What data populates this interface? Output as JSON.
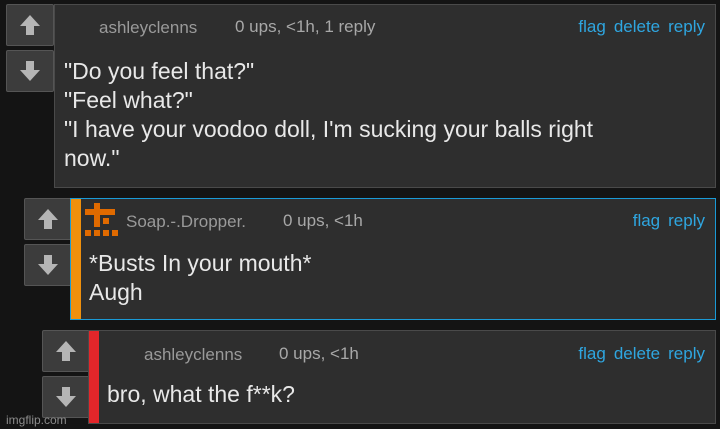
{
  "comments": [
    {
      "username": "ashleyclenns",
      "meta": "0 ups, <1h, 1 reply",
      "actions": {
        "flag": "flag",
        "delete": "delete",
        "reply": "reply"
      },
      "lines": [
        "\"Do you feel that?\"",
        "\"Feel what?\"",
        "\"I have your voodoo doll, I'm sucking your balls right",
        "now.\""
      ]
    },
    {
      "username": "Soap.-.Dropper.",
      "meta": "0 ups, <1h",
      "actions": {
        "flag": "flag",
        "reply": "reply"
      },
      "lines": [
        "*Busts In your mouth*",
        "Augh"
      ],
      "stripe_color": "#f0900c",
      "avatar_color": "#e06a00"
    },
    {
      "username": "ashleyclenns",
      "meta": "0 ups, <1h",
      "actions": {
        "flag": "flag",
        "delete": "delete",
        "reply": "reply"
      },
      "lines": [
        "bro, what the f**k?"
      ],
      "stripe_color": "#e3262a"
    }
  ],
  "watermark": "imgflip.com",
  "icons": [
    "arrow-up-icon",
    "arrow-down-icon"
  ],
  "colors": {
    "background": "#141414",
    "card": "#2e2e2e",
    "link": "#2fa6e0",
    "highlight_border": "#1a9ad6"
  }
}
